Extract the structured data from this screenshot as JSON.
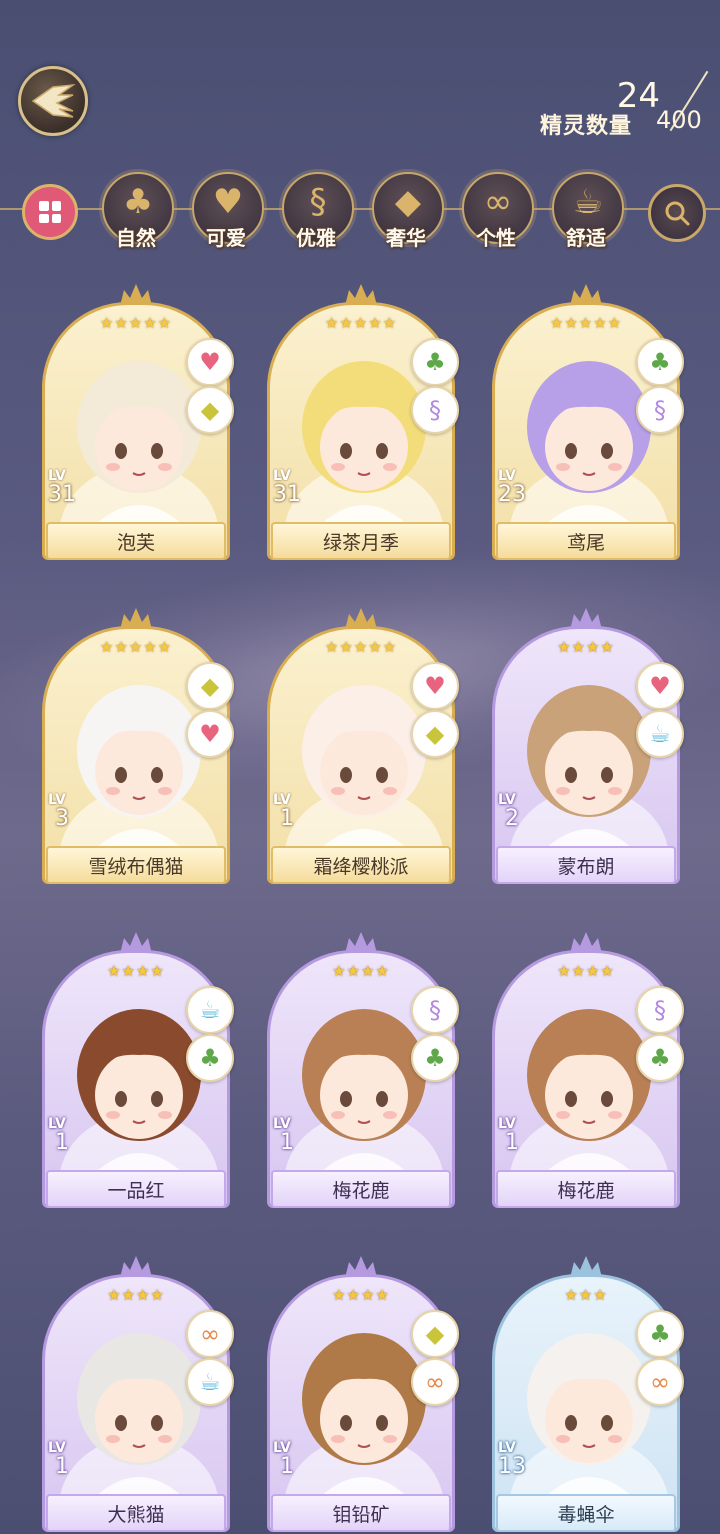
{
  "header": {
    "spirit_count_label": "精灵数量",
    "spirit_count_current": "24",
    "spirit_count_max": "400"
  },
  "filters": [
    {
      "label": "",
      "icon": "grid-icon",
      "active": true
    },
    {
      "label": "自然",
      "icon": "clover-icon"
    },
    {
      "label": "可爱",
      "icon": "heart-icon"
    },
    {
      "label": "优雅",
      "icon": "swan-icon"
    },
    {
      "label": "奢华",
      "icon": "diamond-icon"
    },
    {
      "label": "个性",
      "icon": "glasses-icon"
    },
    {
      "label": "舒适",
      "icon": "teacup-icon"
    },
    {
      "label": "",
      "icon": "search-icon"
    }
  ],
  "cards": [
    {
      "name": "泡芙",
      "lv_label": "LV",
      "level": "31",
      "stars": "★★★★★",
      "rarity": "gold",
      "attrs": [
        "heart-icon",
        "diamond-icon"
      ],
      "hair": "#f3ead8"
    },
    {
      "name": "绿茶月季",
      "lv_label": "LV",
      "level": "31",
      "stars": "★★★★★",
      "rarity": "gold",
      "attrs": [
        "clover-icon",
        "swan-icon"
      ],
      "hair": "#f3dd7a"
    },
    {
      "name": "鸢尾",
      "lv_label": "LV",
      "level": "23",
      "stars": "★★★★★",
      "rarity": "gold",
      "attrs": [
        "clover-icon",
        "swan-icon"
      ],
      "hair": "#b8a0e8"
    },
    {
      "name": "雪绒布偶猫",
      "lv_label": "LV",
      "level": "3",
      "stars": "★★★★★",
      "rarity": "gold",
      "attrs": [
        "diamond-icon",
        "heart-icon"
      ],
      "hair": "#f7f4f4"
    },
    {
      "name": "霜绛樱桃派",
      "lv_label": "LV",
      "level": "1",
      "stars": "★★★★★",
      "rarity": "gold",
      "attrs": [
        "heart-icon",
        "diamond-icon"
      ],
      "hair": "#fbefe8"
    },
    {
      "name": "蒙布朗",
      "lv_label": "LV",
      "level": "2",
      "stars": "★★★★",
      "rarity": "purple",
      "attrs": [
        "heart-icon",
        "teacup-icon"
      ],
      "hair": "#c9a27a"
    },
    {
      "name": "一品红",
      "lv_label": "LV",
      "level": "1",
      "stars": "★★★★",
      "rarity": "purple",
      "attrs": [
        "teacup-icon",
        "clover-icon"
      ],
      "hair": "#8a4a2e"
    },
    {
      "name": "梅花鹿",
      "lv_label": "LV",
      "level": "1",
      "stars": "★★★★",
      "rarity": "purple",
      "attrs": [
        "swan-icon",
        "clover-icon"
      ],
      "hair": "#b98056"
    },
    {
      "name": "梅花鹿",
      "lv_label": "LV",
      "level": "1",
      "stars": "★★★★",
      "rarity": "purple",
      "attrs": [
        "swan-icon",
        "clover-icon"
      ],
      "hair": "#b98056"
    },
    {
      "name": "大熊猫",
      "lv_label": "LV",
      "level": "1",
      "stars": "★★★★",
      "rarity": "purple",
      "attrs": [
        "glasses-icon",
        "teacup-icon"
      ],
      "hair": "#e9e7e4"
    },
    {
      "name": "钼铅矿",
      "lv_label": "LV",
      "level": "1",
      "stars": "★★★★",
      "rarity": "purple",
      "attrs": [
        "diamond-icon",
        "glasses-icon"
      ],
      "hair": "#b07a48"
    },
    {
      "name": "毒蝇伞",
      "lv_label": "LV",
      "level": "13",
      "stars": "★★★",
      "rarity": "blue",
      "attrs": [
        "clover-icon",
        "glasses-icon"
      ],
      "hair": "#f5f1ee"
    }
  ],
  "colors": {
    "gold_frame": "#d9ae52",
    "purple_frame": "#b69ae0",
    "blue_frame": "#9dc2de",
    "heart": "#e8637e",
    "clover": "#5fa84a",
    "swan": "#b48ae0",
    "diamond": "#c9c43a",
    "teacup": "#5ab8d8",
    "glasses": "#e8884a"
  }
}
